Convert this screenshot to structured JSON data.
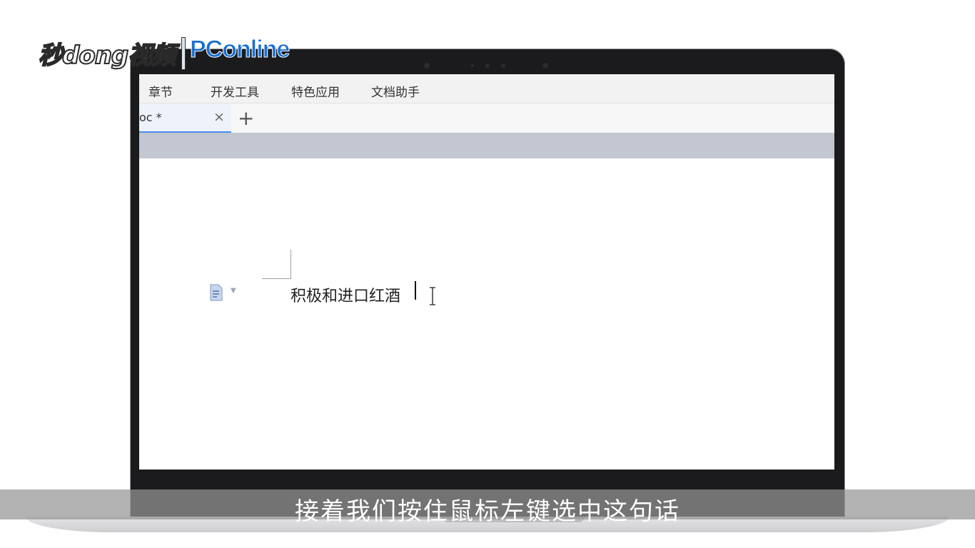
{
  "watermark": {
    "left_text": "秒dong视频",
    "right_text": "PConline"
  },
  "menu": {
    "items": [
      "章节",
      "开发工具",
      "特色应用",
      "文档助手"
    ]
  },
  "tabs": {
    "active_label": "oc *",
    "close_glyph": "×",
    "new_tab_glyph": "+"
  },
  "document": {
    "text": "积极和进口红酒"
  },
  "subtitle": {
    "text": "接着我们按住鼠标左键选中这句话"
  },
  "colors": {
    "tab_accent": "#4b8ef0",
    "toolbar_strip": "#c2c7d2",
    "watermark_blue": "#1a6fd1"
  },
  "icons": {
    "paragraph_handle": "document-icon",
    "cursor": "ibeam-cursor-icon"
  }
}
